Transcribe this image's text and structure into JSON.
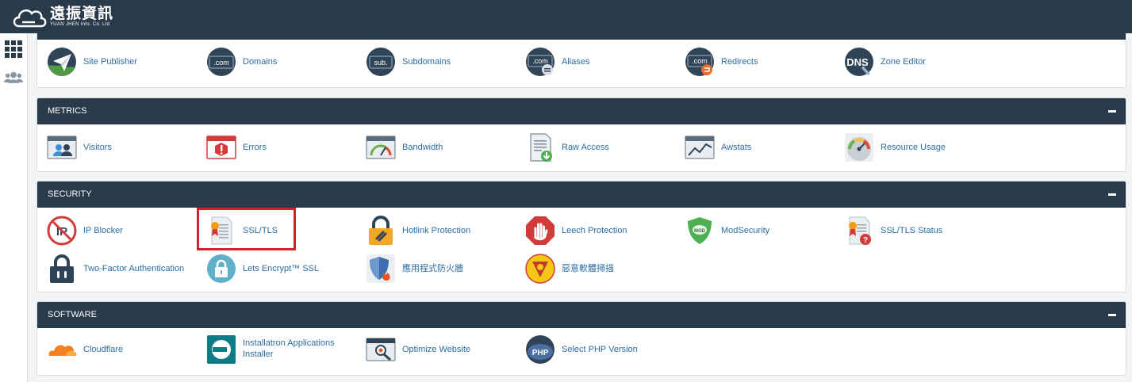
{
  "brand": {
    "name": "遠振資訊",
    "tagline": "YUAN JHEN Info. Co. Ltd"
  },
  "leftnav": [
    {
      "name": "apps-grid-icon"
    },
    {
      "name": "users-icon"
    }
  ],
  "sections": {
    "domains": {
      "items": [
        "Site Publisher",
        "Domains",
        "Subdomains",
        "Aliases",
        "Redirects",
        "Zone Editor"
      ]
    },
    "metrics": {
      "title": "METRICS",
      "items": [
        "Visitors",
        "Errors",
        "Bandwidth",
        "Raw Access",
        "Awstats",
        "Resource Usage"
      ]
    },
    "security": {
      "title": "SECURITY",
      "items": [
        "IP Blocker",
        "SSL/TLS",
        "Hotlink Protection",
        "Leech Protection",
        "ModSecurity",
        "SSL/TLS Status",
        "Two-Factor Authentication",
        "Lets Encrypt™ SSL",
        "應用程式防火牆",
        "惡意軟體掃描"
      ]
    },
    "software": {
      "title": "SOFTWARE",
      "items": [
        "Cloudflare",
        "Installatron Applications Installer",
        "Optimize Website",
        "Select PHP Version"
      ]
    }
  },
  "icon_texts": {
    "com": ".com",
    "sub": "sub.",
    "dns": "DNS",
    "mod": "MOD",
    "php": "PHP",
    "ip": "IP"
  },
  "highlight": {
    "target": "SSL/TLS",
    "color": "#d42028"
  },
  "colors": {
    "topbar": "#293a4a",
    "link": "#2b6ca3"
  }
}
